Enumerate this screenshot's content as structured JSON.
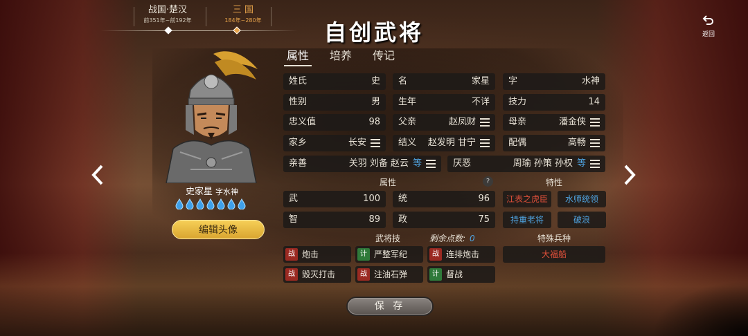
{
  "eras": [
    {
      "name": "战国·楚汉",
      "range": "前351年~前192年"
    },
    {
      "name": "三 国",
      "range": "184年~280年"
    }
  ],
  "title": "自创武将",
  "back_label": "返回",
  "tabs": [
    "属性",
    "培养",
    "传记"
  ],
  "hero": {
    "name": "史家星",
    "courtesy": "字水神",
    "stars": 7
  },
  "edit_avatar_label": "编辑头像",
  "info": {
    "surname": {
      "label": "姓氏",
      "value": "史"
    },
    "given": {
      "label": "名",
      "value": "家星"
    },
    "courtesy": {
      "label": "字",
      "value": "水神"
    },
    "gender": {
      "label": "性别",
      "value": "男"
    },
    "birth": {
      "label": "生年",
      "value": "不详"
    },
    "skill": {
      "label": "技力",
      "value": "14"
    },
    "loyalty": {
      "label": "忠义值",
      "value": "98"
    },
    "father": {
      "label": "父亲",
      "value": "赵凤财"
    },
    "mother": {
      "label": "母亲",
      "value": "潘金侠"
    },
    "hometown": {
      "label": "家乡",
      "value": "长安"
    },
    "sworn": {
      "label": "结义",
      "value": "赵发明 甘宁"
    },
    "spouse": {
      "label": "配偶",
      "value": "高畅"
    },
    "likes": {
      "label": "亲善",
      "value": "关羽 刘备 赵云",
      "more": "等"
    },
    "dislikes": {
      "label": "厌恶",
      "value": "周瑜 孙策 孙权",
      "more": "等"
    }
  },
  "attributes_label": "属性",
  "traits_label": "特性",
  "attributes": [
    {
      "label": "武",
      "value": "100"
    },
    {
      "label": "统",
      "value": "96"
    },
    {
      "label": "智",
      "value": "89"
    },
    {
      "label": "政",
      "value": "75"
    }
  ],
  "traits": [
    {
      "label": "江表之虎臣",
      "color": "#e0503a"
    },
    {
      "label": "水师统领",
      "color": "#4fa3e0"
    },
    {
      "label": "持重老将",
      "color": "#4fa3e0"
    },
    {
      "label": "破浪",
      "color": "#4fa3e0"
    }
  ],
  "skills_label": "武将技",
  "remaining_label": "剩余点数:",
  "remaining_points": "0",
  "skills": [
    {
      "tag": "战",
      "name": "炮击"
    },
    {
      "tag": "计",
      "name": "严整军纪"
    },
    {
      "tag": "战",
      "name": "连排炮击"
    },
    {
      "tag": "战",
      "name": "毁灭打击"
    },
    {
      "tag": "战",
      "name": "注油石弹"
    },
    {
      "tag": "计",
      "name": "督战"
    }
  ],
  "special_troop_label": "特殊兵种",
  "special_troop": "大福船",
  "save_label": "保 存",
  "colors": {
    "accent": "#e6a24a",
    "blue": "#4fa3e0",
    "red_trait": "#e0503a",
    "button_gold": "#f6cf57"
  },
  "icons": [
    "back-icon",
    "left-arrow-icon",
    "right-arrow-icon",
    "menu-icon",
    "star-drop-icon",
    "help-icon"
  ]
}
